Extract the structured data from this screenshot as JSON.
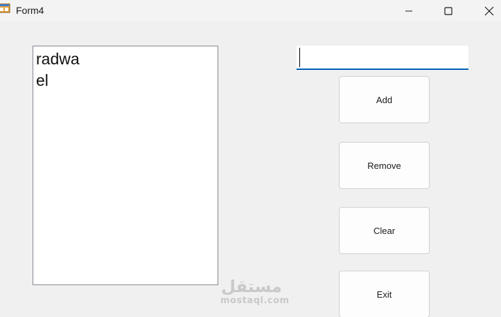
{
  "window": {
    "title": "Form4"
  },
  "listbox": {
    "items": [
      "radwa",
      "el"
    ]
  },
  "textbox": {
    "value": ""
  },
  "buttons": {
    "add": "Add",
    "remove": "Remove",
    "clear": "Clear",
    "exit": "Exit"
  },
  "watermark": {
    "arabic": "مستقل",
    "latin": "mostaql.com"
  },
  "colors": {
    "background": "#f0f0f0",
    "textbox_focus": "#005fb8",
    "listbox_border": "#828790"
  }
}
